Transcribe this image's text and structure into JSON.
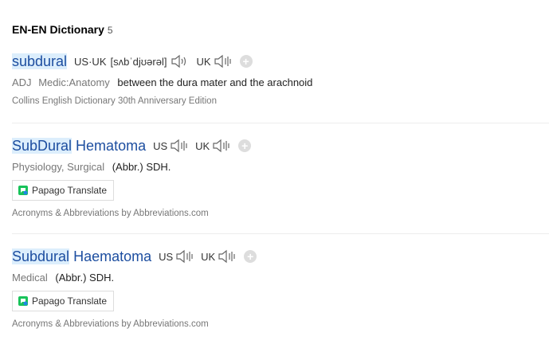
{
  "header": {
    "title": "EN-EN Dictionary",
    "count": "5"
  },
  "entries": [
    {
      "word_hl": "subdural",
      "word_rest": "",
      "pron": {
        "us_uk_label": "US·UK",
        "phonetic": "[sʌbˈdjʊərəl]",
        "uk_label": "UK"
      },
      "pos": "ADJ",
      "field": "Medic:Anatomy",
      "gloss": "between the dura mater and the arachnoid",
      "source": "Collins English Dictionary 30th Anniversary Edition"
    },
    {
      "word_hl": "SubDural",
      "word_rest": " Hematoma",
      "pron": {
        "us_label": "US",
        "uk_label": "UK"
      },
      "field": "Physiology, Surgical",
      "gloss": "(Abbr.) SDH.",
      "button": "Papago Translate",
      "source": "Acronyms & Abbreviations by Abbreviations.com"
    },
    {
      "word_hl": "Subdural",
      "word_rest": " Haematoma",
      "pron": {
        "us_label": "US",
        "uk_label": "UK"
      },
      "field": "Medical",
      "gloss": "(Abbr.) SDH.",
      "button": "Papago Translate",
      "source": "Acronyms & Abbreviations by Abbreviations.com"
    }
  ],
  "icons": {
    "speaker": "speaker-icon",
    "add": "add-icon",
    "papago": "papago-logo-icon"
  },
  "colors": {
    "word": "#1d4ea0",
    "highlight": "#dceefc",
    "muted": "#777777"
  }
}
